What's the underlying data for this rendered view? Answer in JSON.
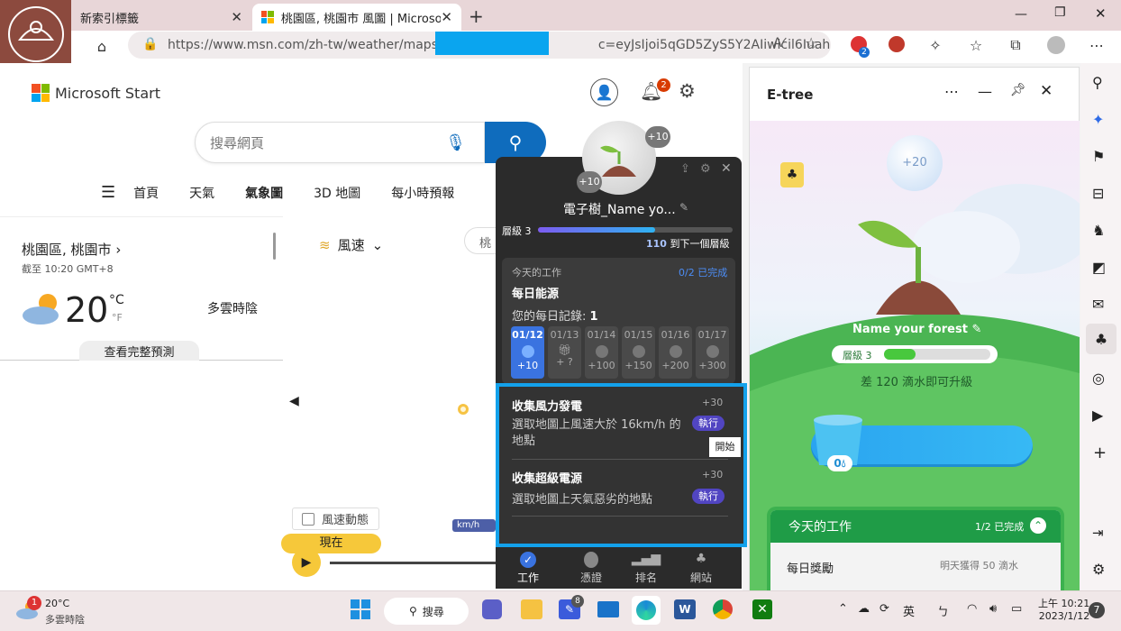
{
  "browser": {
    "tabs": [
      {
        "title": "新索引標籤"
      },
      {
        "title": "桃園區, 桃園市 風圖 | Microsoft Start"
      }
    ],
    "url_left": "https://www.msn.com/zh-tw/weather/maps/wind",
    "url_right": "c=eyJsIjoi5qGD5ZyS5Y2AIiwicil6Iuahg...",
    "extension_badge": "2"
  },
  "msn": {
    "brand": "Microsoft Start",
    "search_placeholder": "搜尋網頁",
    "notification_count": "2",
    "nav": [
      "首頁",
      "天氣",
      "氣象圖",
      "3D 地圖",
      "每小時預報"
    ],
    "location": "桃園區, 桃園市",
    "updated": "截至 10:20 GMT+8",
    "temp": "20",
    "unit_c": "°C",
    "unit_f": "°F",
    "condition": "多雲時陰",
    "forecast_btn": "查看完整預測",
    "layer": "風速",
    "location_chip": "桃",
    "wind_toggle": "風速動態",
    "now_label": "現在",
    "speed_unit": "km/h"
  },
  "tree_popup": {
    "plus_top": "+10",
    "plus_bottom": "+10",
    "name": "電子樹_Name yo...",
    "level_label": "層級 3",
    "next_level_num": "110",
    "next_level_text": "到下一個層級",
    "progress": 0.6,
    "today_tasks": "今天的工作",
    "completed": "0/2 已完成",
    "daily_energy": "每日能源",
    "daily_record_label": "您的每日記錄:",
    "daily_record_value": "1",
    "days": [
      {
        "date": "01/12",
        "reward": "+10"
      },
      {
        "date": "01/13",
        "reward": "+ ?"
      },
      {
        "date": "01/14",
        "reward": "+100"
      },
      {
        "date": "01/15",
        "reward": "+150"
      },
      {
        "date": "01/16",
        "reward": "+200"
      },
      {
        "date": "01/17",
        "reward": "+300"
      }
    ],
    "task1_title": "收集風力發電",
    "task1_points": "+30",
    "task1_desc": "選取地圖上風速大於 16km/h 的地點",
    "task1_btn": "執行",
    "tooltip": "開始",
    "task2_title": "收集超級電源",
    "task2_points": "+30",
    "task2_desc": "選取地圖上天氣惡劣的地點",
    "task2_btn": "執行",
    "tabs": [
      "工作",
      "憑證",
      "排名",
      "網站"
    ]
  },
  "etree": {
    "title": "E-tree",
    "bubble": "+20",
    "forest_name": "Name your forest",
    "level": "層級 3",
    "upgrade_hint": "差 120 滴水即可升級",
    "water_count": "0",
    "today_tasks": "今天的工作",
    "completed": "1/2 已完成",
    "daily_reward": "每日獎勵",
    "daily_reward_hint": "明天獲得 50 滴水"
  },
  "taskbar": {
    "weather_temp": "20°C",
    "weather_desc": "多雲時陰",
    "weather_badge": "1",
    "search_label": "搜尋",
    "app_badge": "8",
    "ime": "英",
    "time": "上午 10:21",
    "date": "2023/1/12",
    "notify_count": "7"
  }
}
